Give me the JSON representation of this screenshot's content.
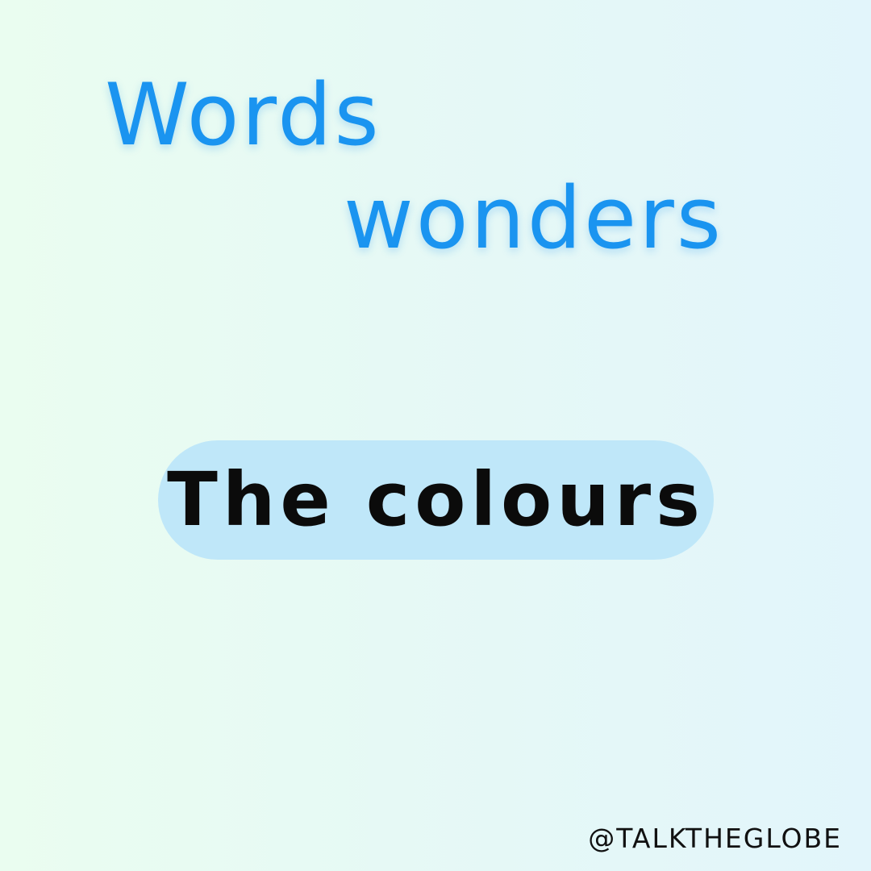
{
  "title": {
    "line1": "Words",
    "line2": "wonders"
  },
  "subtitle": {
    "label": "The colours"
  },
  "footer": {
    "handle": "@TALKTHEGLOBE"
  },
  "colors": {
    "title": "#1a94f0",
    "pill": "#bfe7f9",
    "text_dark": "#0b0b0b",
    "bg_left": "#eafdf0",
    "bg_right": "#e2f5fb"
  }
}
